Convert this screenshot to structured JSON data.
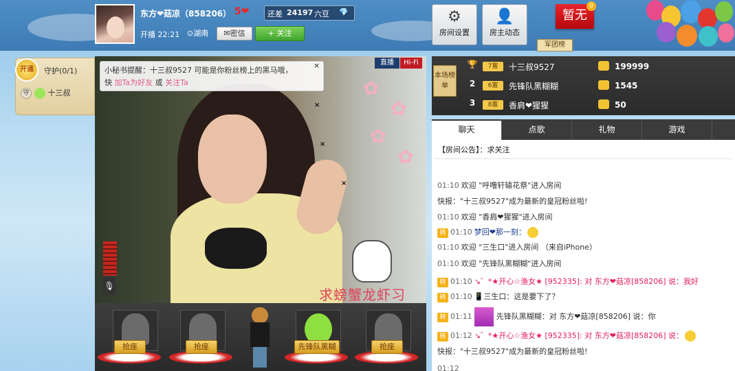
{
  "host": {
    "name": "东方❤菇凉（858206）",
    "level": "5",
    "gap_label": "还差",
    "gap_value": "24197",
    "gap_suffix": "六豆",
    "live_label": "开播",
    "live_time": "22:21",
    "location": "湖南",
    "message_label": "密信",
    "follow_label": "+ 关注"
  },
  "toolbar": {
    "room_settings": "房间设置",
    "host_feed": "房主动态",
    "no_group": "暂无",
    "no_group_badge": "0",
    "group_rank": "军团榜"
  },
  "guard": {
    "badge": "开通",
    "title": "守护(0/1)",
    "member_prefix": "守",
    "member_name": "十三叔"
  },
  "video": {
    "tip_line1": "小秘书提醒：十三叔9527 可能是你粉丝榜上的黑马哦，",
    "tip_line2_a": "快 ",
    "tip_add_friend": "加Ta为好友",
    "tip_or": " 或 ",
    "tip_follow": "关注Ta",
    "close": "×",
    "live_badge": "直播",
    "hifi_badge": "Hi-Fi",
    "banner": "求螃蟹龙虾习"
  },
  "seats": [
    {
      "label": "抢座"
    },
    {
      "label": "抢座"
    },
    {
      "label": "先锋队黑糊"
    },
    {
      "label": "抢座"
    }
  ],
  "rank": {
    "label": "本场榜单",
    "rows": [
      {
        "no": "1",
        "level": "7富",
        "name": "十三叔9527",
        "value": "199999"
      },
      {
        "no": "2",
        "level": "6富",
        "name": "先锋队黑糊糊",
        "value": "1545"
      },
      {
        "no": "3",
        "level": "8富",
        "name": "香肩❤猩猩",
        "value": "50"
      }
    ]
  },
  "chat": {
    "tabs": [
      "聊天",
      "点歌",
      "礼物",
      "游戏"
    ],
    "notice": "【房间公告】：求关注",
    "messages": [
      {
        "time": "01:10",
        "text": "欢迎 \"呼噜轩辕花祭\"进入房间"
      },
      {
        "time": "",
        "text": "快报：\"十三叔9527\"成为最新的皇冠粉丝啦!"
      },
      {
        "time": "01:10",
        "text": "欢迎 \"香肩❤猩猩\"进入房间"
      },
      {
        "time": "01:10",
        "text": "梦回❤那一刻：",
        "zhuan": "转"
      },
      {
        "time": "01:10",
        "text": "欢迎 \"三生口\"进入房间 （来自iPhone）"
      },
      {
        "time": "01:10",
        "text": "欢迎 \"先锋队黑糊糊\"进入房间"
      },
      {
        "time": "01:10",
        "text": "↘゛*★开心☆渔女★ [952335]: 对 东方❤菇凉[858206] 说：我好",
        "zhuan": "转"
      },
      {
        "time": "01:10",
        "text": "三生口：这是要下了？",
        "zhuan": "转"
      },
      {
        "time": "01:11",
        "text": "先锋队黑糊糊：对 东方❤菇凉[858206] 说：你",
        "zhuan": "转"
      },
      {
        "time": "01:12",
        "text": "↘゛*★开心☆渔女★ [952335]: 对 东方❤菇凉[858206] 说：",
        "zhuan": "转"
      },
      {
        "time": "",
        "text": "快报：\"十三叔9527\"成为最新的皇冠粉丝啦!"
      },
      {
        "time": "01:12",
        "text": ""
      }
    ]
  }
}
